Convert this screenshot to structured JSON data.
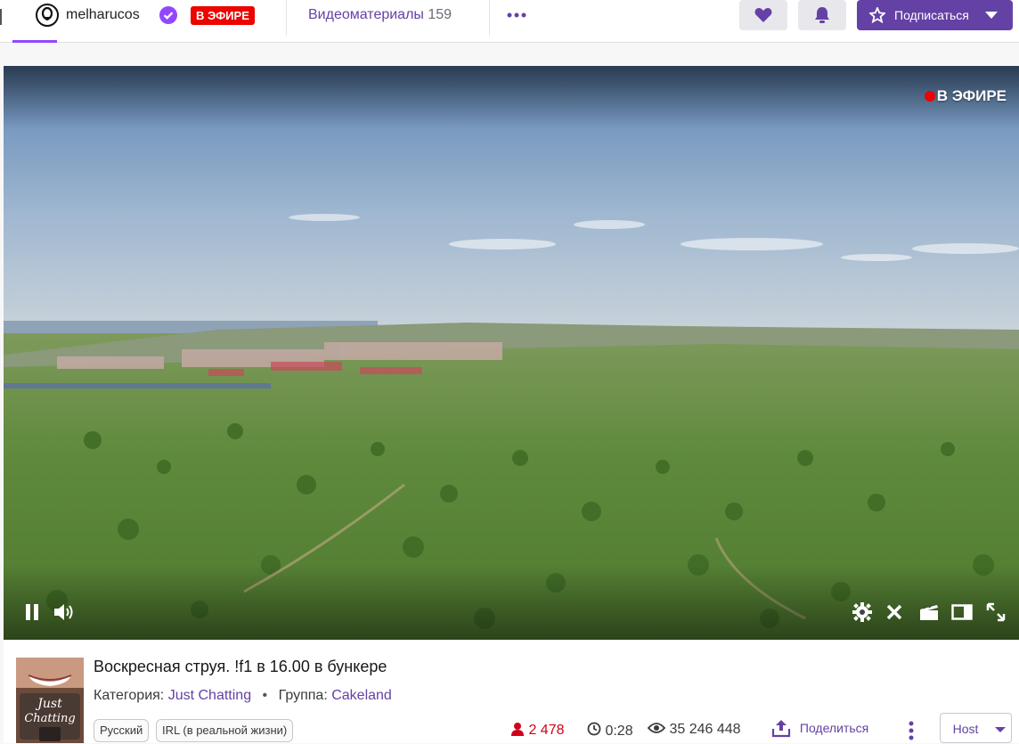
{
  "topbar": {
    "channel_name": "melharucos",
    "live_badge": "В ЭФИРЕ",
    "videos_label": "Видеоматериалы",
    "videos_count": "159",
    "more_icon": "more-dots-icon",
    "heart_icon": "heart-icon",
    "bell_icon": "bell-icon",
    "subscribe_label": "Подписаться",
    "accent_color": "#6441a5",
    "live_color": "#eb0400"
  },
  "player": {
    "live_label": "В ЭФИРЕ",
    "controls_left": [
      "pause-icon",
      "volume-icon"
    ],
    "controls_right": [
      "settings-icon",
      "close-icon",
      "clip-icon",
      "theatre-mode-icon",
      "fullscreen-icon"
    ]
  },
  "info": {
    "thumbnail_text_1": "Just",
    "thumbnail_text_2": "Chatting",
    "title": "Воскресная струя. !f1 в 16.00 в бункере",
    "category_label": "Категория:",
    "category_value": "Just Chatting",
    "bullet": "•",
    "group_label": "Группа:",
    "group_value": "Cakeland",
    "tags": [
      "Русский",
      "IRL (в реальной жизни)"
    ],
    "viewers": "2 478",
    "uptime": "0:28",
    "total_views": "35 246 448",
    "share_label": "Поделиться",
    "host_label": "Host"
  }
}
